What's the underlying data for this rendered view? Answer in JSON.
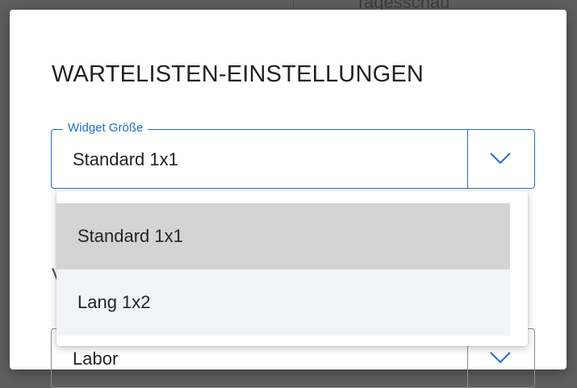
{
  "background": {
    "header_text": "Tagesschau"
  },
  "dialog": {
    "title": "WARTELISTEN-EINSTELLUNGEN",
    "widget_size": {
      "label": "Widget Größe",
      "value": "Standard 1x1",
      "chevron_icon": "chevron-down-icon",
      "options": [
        {
          "label": "Standard 1x1",
          "selected": true
        },
        {
          "label": "Lang 1x2",
          "selected": false
        }
      ]
    },
    "second_field": {
      "label_peek": "V",
      "value": "Labor",
      "chevron_icon": "chevron-down-icon"
    }
  },
  "colors": {
    "accent": "#1f6fc9",
    "overlay": "#5e5e5e",
    "selected_option": "#d4d4d4",
    "option_bg": "#f1f3f7"
  }
}
